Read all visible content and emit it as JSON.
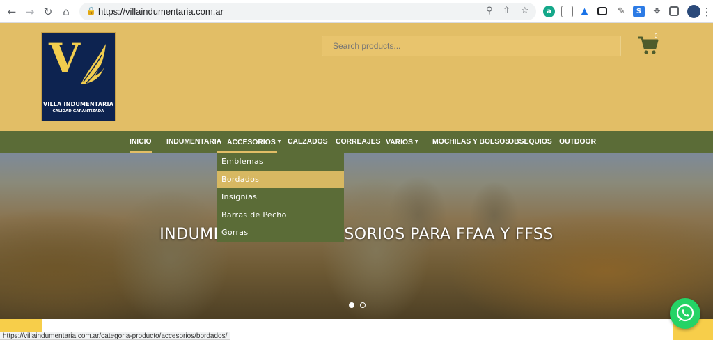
{
  "browser": {
    "url": "https://villaindumentaria.com.ar",
    "extensions": [
      "a",
      "S"
    ]
  },
  "header": {
    "logo": {
      "name": "VILLA INDUMENTARIA",
      "tagline": "CALIDAD GARANTIZADA"
    },
    "search_placeholder": "Search products...",
    "cart_count": "0"
  },
  "menu": {
    "items": [
      {
        "label": "INICIO",
        "active": true
      },
      {
        "label": "INDUMENTARIA"
      },
      {
        "label": "ACCESORIOS",
        "has_submenu": true
      },
      {
        "label": "CALZADOS"
      },
      {
        "label": "CORREAJES"
      },
      {
        "label": "VARIOS",
        "has_submenu": true
      },
      {
        "label": "MOCHILAS Y BOLSOS"
      },
      {
        "label": "OBSEQUIOS"
      },
      {
        "label": "OUTDOOR"
      }
    ],
    "caret": "▼",
    "submenu_accesorios": [
      "Emblemas",
      "Bordados",
      "Insignias",
      "Barras de Pecho",
      "Gorras"
    ],
    "hovered_submenu_item": "Bordados"
  },
  "hero": {
    "text": "INDUMENTARIA Y ACCESORIOS PARA FFAA Y FFSS",
    "slide_count": 2,
    "active_slide": 1
  },
  "status_bar": {
    "url": "https://villaindumentaria.com.ar/categoria-producto/accesorios/bordados/"
  },
  "colors": {
    "header_bg": "#e2be66",
    "menu_bg": "#5b6c37",
    "logo_bg": "#0d2350",
    "whatsapp": "#25d366"
  }
}
